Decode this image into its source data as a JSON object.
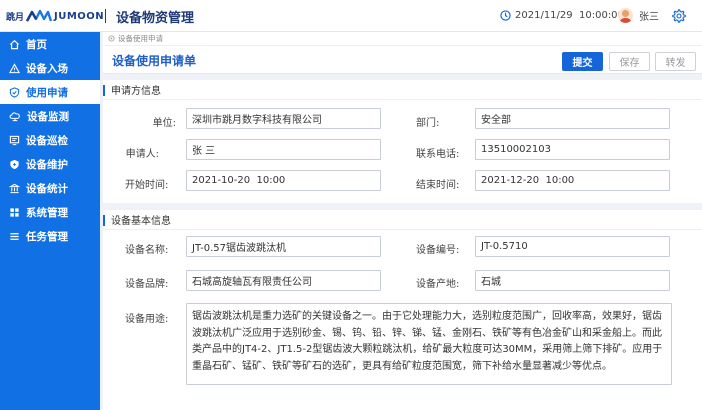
{
  "header": {
    "logo_cn": "跳月",
    "logo_en": "JUMOON",
    "app_title": "设备物资管理",
    "datetime": "2021/11/29  10:00:00",
    "user_name": "张三"
  },
  "icons": {
    "clock": "clock-icon",
    "settings": "gear-icon",
    "breadcrumb": "location-icon"
  },
  "colors": {
    "sidebar": "#1170e4",
    "primary": "#1565d8",
    "title": "#1f3a77"
  },
  "sidebar": {
    "items": [
      {
        "label": "首页",
        "icon": "home-icon"
      },
      {
        "label": "设备入场",
        "icon": "warning-icon"
      },
      {
        "label": "使用申请",
        "icon": "shield-icon"
      },
      {
        "label": "设备监测",
        "icon": "monitor-icon"
      },
      {
        "label": "设备巡检",
        "icon": "inspect-icon"
      },
      {
        "label": "设备维护",
        "icon": "maintain-icon"
      },
      {
        "label": "设备统计",
        "icon": "stats-icon"
      },
      {
        "label": "系统管理",
        "icon": "grid-icon"
      },
      {
        "label": "任务管理",
        "icon": "list-icon"
      }
    ]
  },
  "breadcrumb": "设备使用申请",
  "page": {
    "title": "设备使用申请单",
    "buttons": {
      "submit": "提交",
      "save": "保存",
      "forward": "转发"
    }
  },
  "applicant": {
    "section_title": "申请方信息",
    "unit_label": "单位:",
    "unit_value": "深圳市跳月数字科技有限公司",
    "dept_label": "部门:",
    "dept_value": "安全部",
    "person_label": "申请人:",
    "person_value": "张 三",
    "phone_label": "联系电话:",
    "phone_value": "13510002103",
    "start_label": "开始时间:",
    "start_value": "2021-10-20  10:00",
    "end_label": "结束时间:",
    "end_value": "2021-12-20  10:00"
  },
  "device": {
    "section_title": "设备基本信息",
    "name_label": "设备名称:",
    "name_value": "JT-0.57锯齿波跳汰机",
    "code_label": "设备编号:",
    "code_value": "JT-0.5710",
    "brand_label": "设备品牌:",
    "brand_value": "石城高旋轴瓦有限责任公司",
    "origin_label": "设备产地:",
    "origin_value": "石城",
    "usage_label": "设备用途:",
    "usage_value": "锯齿波跳汰机是重力选矿的关键设备之一。由于它处理能力大，选别粒度范围广，回收率高，效果好，锯齿波跳汰机广泛应用于选别砂金、锡、钨、铅、锌、锑、锰、金刚石、铁矿等有色冶金矿山和采金船上。而此类产品中的JT4-2、JT1.5-2型锯齿波大颗粒跳汰机，给矿最大粒度可达30MM，采用筛上筛下排矿。应用于重晶石矿、锰矿、铁矿等矿石的选矿，更具有给矿粒度范围宽，筛下补给水量显著减少等优点。"
  }
}
